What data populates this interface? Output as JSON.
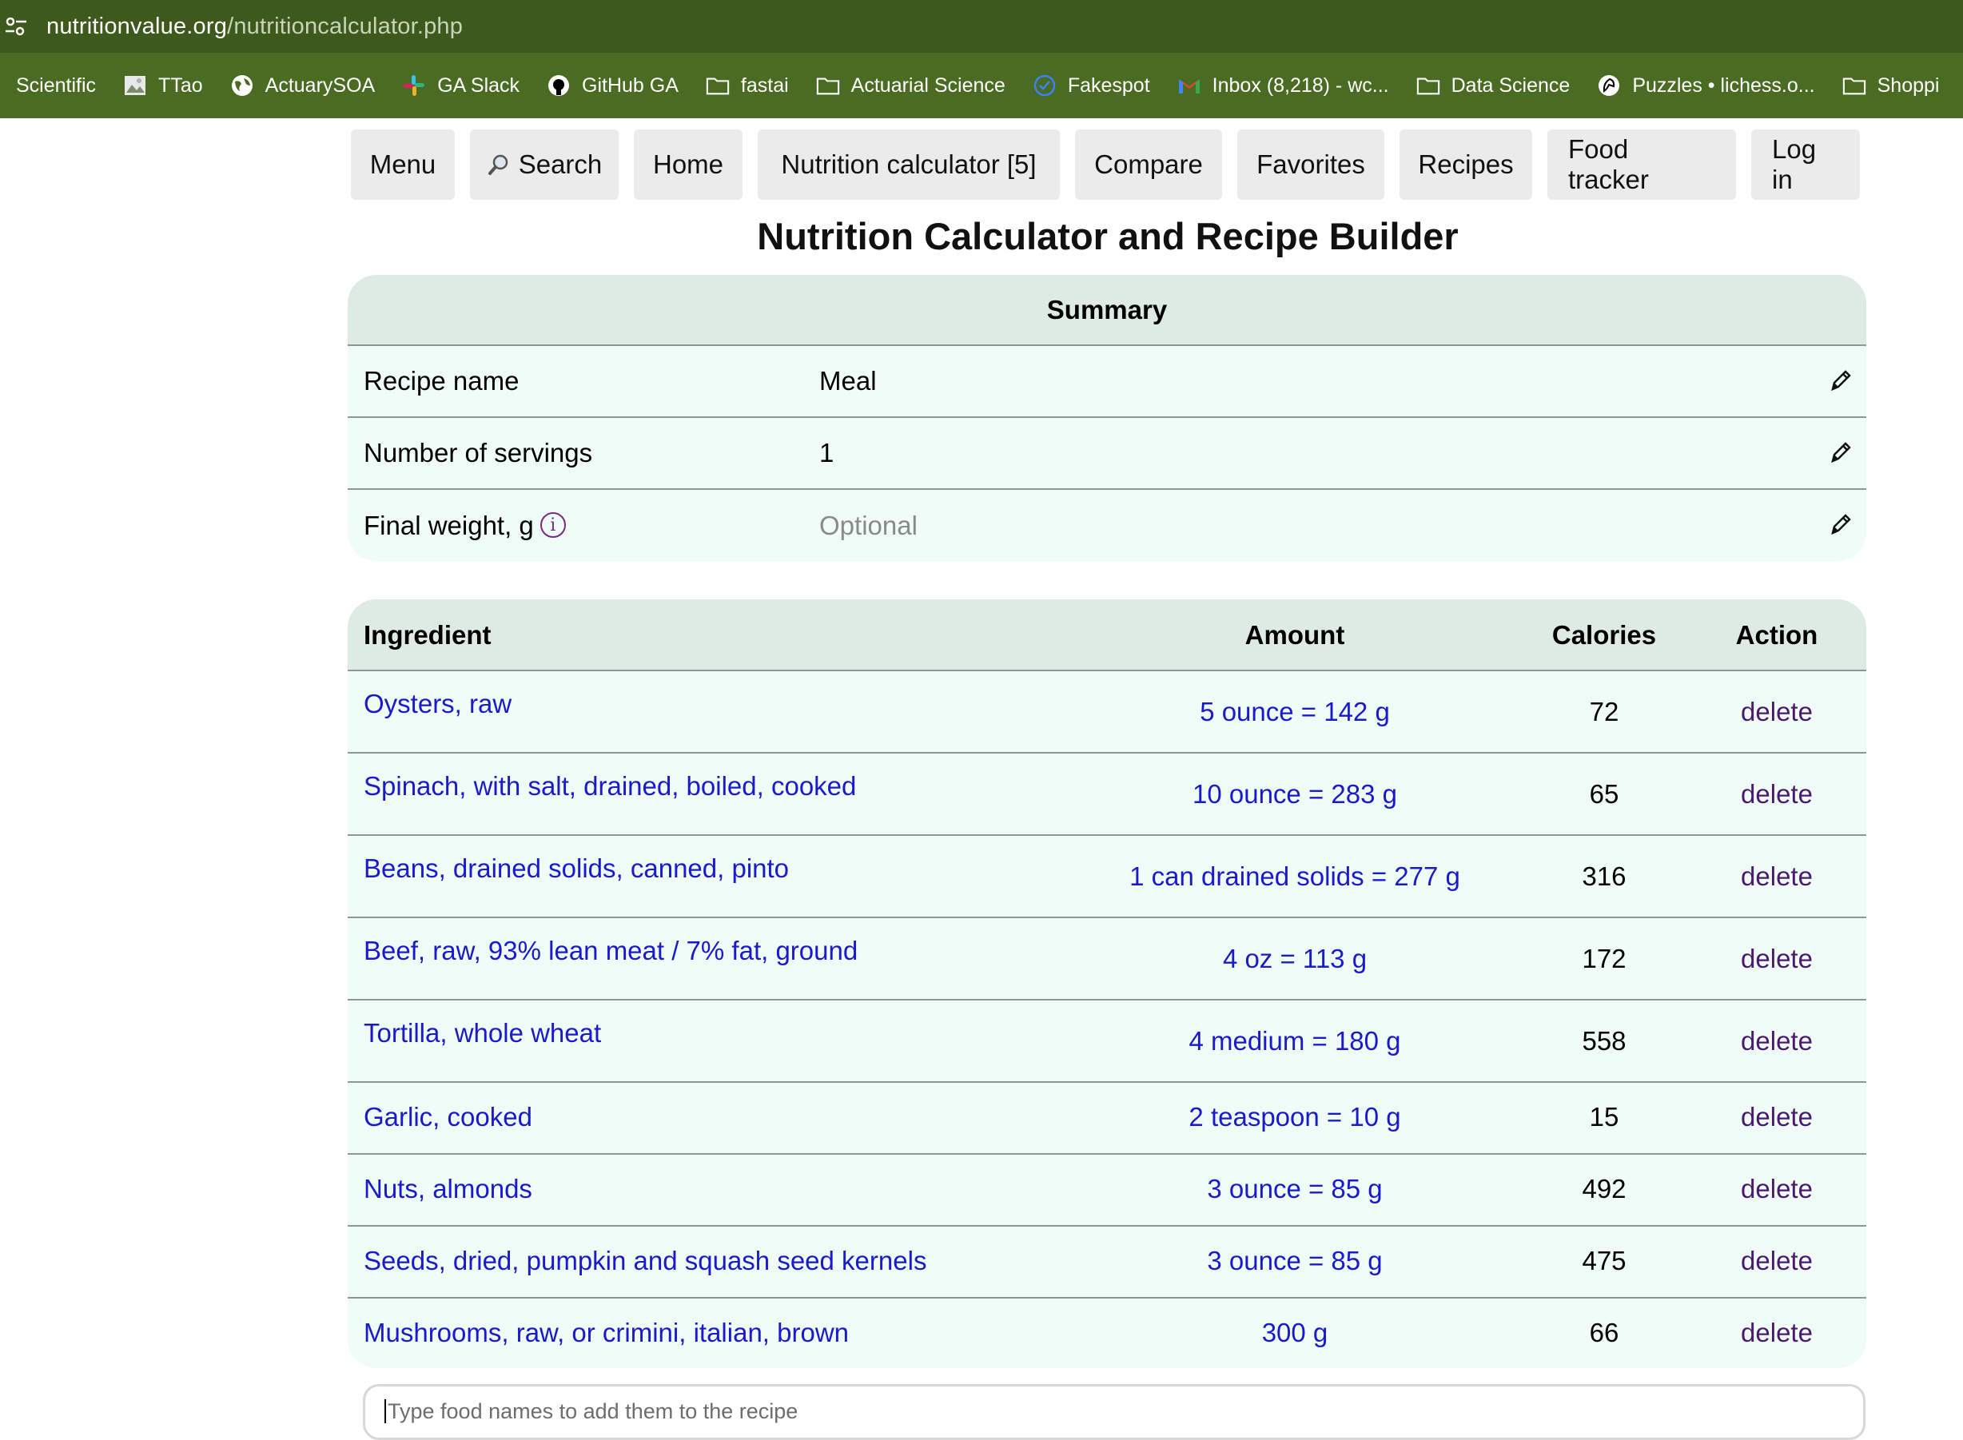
{
  "browser": {
    "url_host": "nutritionvalue.org",
    "url_path": "/nutritioncalculator.php"
  },
  "bookmarks": [
    {
      "label": "Scientific",
      "icon": "none"
    },
    {
      "label": "TTao",
      "icon": "image-icon"
    },
    {
      "label": "ActuarySOA",
      "icon": "globe-icon"
    },
    {
      "label": "GA Slack",
      "icon": "slack-icon"
    },
    {
      "label": "GitHub GA",
      "icon": "github-icon"
    },
    {
      "label": "fastai",
      "icon": "folder-icon"
    },
    {
      "label": "Actuarial Science",
      "icon": "folder-icon"
    },
    {
      "label": "Fakespot",
      "icon": "check-circle-icon"
    },
    {
      "label": "Inbox (8,218) - wc...",
      "icon": "gmail-icon"
    },
    {
      "label": "Data Science",
      "icon": "folder-icon"
    },
    {
      "label": "Puzzles • lichess.o...",
      "icon": "lichess-icon"
    },
    {
      "label": "Shoppi",
      "icon": "folder-icon"
    }
  ],
  "nav": {
    "menu": "Menu",
    "search": "Search",
    "home": "Home",
    "calculator": "Nutrition calculator [5]",
    "compare": "Compare",
    "favorites": "Favorites",
    "recipes": "Recipes",
    "food_tracker": "Food tracker",
    "login": "Log in"
  },
  "page": {
    "title": "Nutrition Calculator and Recipe Builder"
  },
  "summary": {
    "heading": "Summary",
    "recipe_name_label": "Recipe name",
    "recipe_name_value": "Meal",
    "servings_label": "Number of servings",
    "servings_value": "1",
    "weight_label": "Final weight, g",
    "weight_placeholder": "Optional",
    "info_glyph": "i"
  },
  "ingredients": {
    "headers": {
      "ingredient": "Ingredient",
      "amount": "Amount",
      "calories": "Calories",
      "action": "Action"
    },
    "rows": [
      {
        "name": "Oysters, raw",
        "amount": "5 ounce = 142 g",
        "calories": "72",
        "action": "delete"
      },
      {
        "name": "Spinach, with salt, drained, boiled, cooked",
        "amount": "10 ounce = 283 g",
        "calories": "65",
        "action": "delete"
      },
      {
        "name": "Beans, drained solids, canned, pinto",
        "amount": "1 can drained solids = 277 g",
        "calories": "316",
        "action": "delete"
      },
      {
        "name": "Beef, raw, 93% lean meat / 7% fat, ground",
        "amount": "4 oz = 113 g",
        "calories": "172",
        "action": "delete"
      },
      {
        "name": "Tortilla, whole wheat",
        "amount": "4 medium = 180 g",
        "calories": "558",
        "action": "delete"
      },
      {
        "name": "Garlic, cooked",
        "amount": "2 teaspoon = 10 g",
        "calories": "15",
        "action": "delete"
      },
      {
        "name": "Nuts, almonds",
        "amount": "3 ounce = 85 g",
        "calories": "492",
        "action": "delete"
      },
      {
        "name": "Seeds, dried, pumpkin and squash seed kernels",
        "amount": "3 ounce = 85 g",
        "calories": "475",
        "action": "delete"
      },
      {
        "name": "Mushrooms, raw, or crimini, italian, brown",
        "amount": "300 g",
        "calories": "66",
        "action": "delete"
      }
    ]
  },
  "add_ingredient": {
    "placeholder": "Type food names to add them to the recipe"
  },
  "colors": {
    "browser_bar": "#3d5a1c",
    "bookmarks_bar": "#4a6b22",
    "panel_bg": "#effcf7",
    "panel_header": "#ddebe3",
    "link": "#1a1acc",
    "delete_link": "#4a1a6e"
  }
}
